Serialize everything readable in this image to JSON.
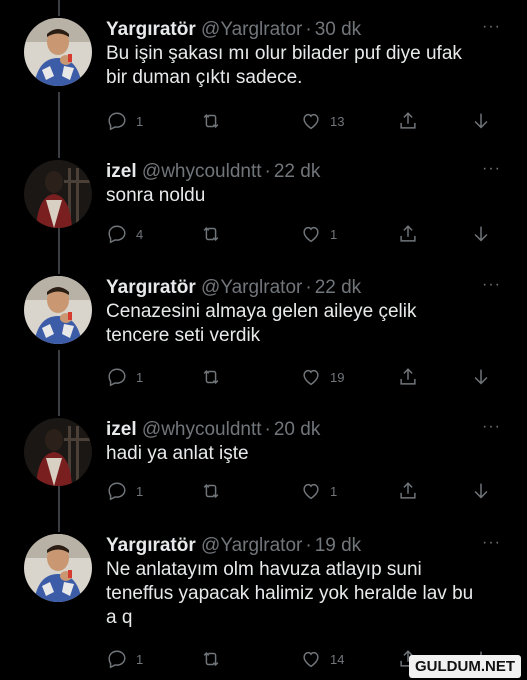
{
  "tweets": [
    {
      "name": "Yargıratör",
      "handle": "@Yarglrator",
      "time": "30 dk",
      "text_lines": [
        "Bu işin şakası mı olur bilader puf diye ufak",
        "bir duman çıktı sadece."
      ],
      "replies": "1",
      "retweets": "",
      "likes": "13",
      "avatar": "boy-avatar"
    },
    {
      "name": "izel",
      "handle": "@whycouldntt",
      "time": "22 dk",
      "text_lines": [
        "sonra noldu"
      ],
      "replies": "4",
      "retweets": "",
      "likes": "1",
      "avatar": "dark-avatar"
    },
    {
      "name": "Yargıratör",
      "handle": "@Yarglrator",
      "time": "22 dk",
      "text_lines": [
        "Cenazesini almaya gelen aileye çelik",
        "tencere seti verdik"
      ],
      "replies": "1",
      "retweets": "",
      "likes": "19",
      "avatar": "boy-avatar"
    },
    {
      "name": "izel",
      "handle": "@whycouldntt",
      "time": "20 dk",
      "text_lines": [
        "hadi ya anlat işte"
      ],
      "replies": "1",
      "retweets": "",
      "likes": "1",
      "avatar": "dark-avatar"
    },
    {
      "name": "Yargıratör",
      "handle": "@Yarglrator",
      "time": "19 dk",
      "text_lines": [
        "Ne anlatayım olm havuza atlayıp suni",
        "teneffus yapacak halimiz yok heralde lav bu",
        "a q"
      ],
      "replies": "1",
      "retweets": "",
      "likes": "14",
      "avatar": "boy-avatar"
    }
  ],
  "separator_dot": "·",
  "more_glyph": "···",
  "watermark": "GULDUM.NET",
  "colors": {
    "background": "#000000",
    "text": "#e7e9ea",
    "muted": "#71767b",
    "thread_line": "#3a3d41"
  }
}
